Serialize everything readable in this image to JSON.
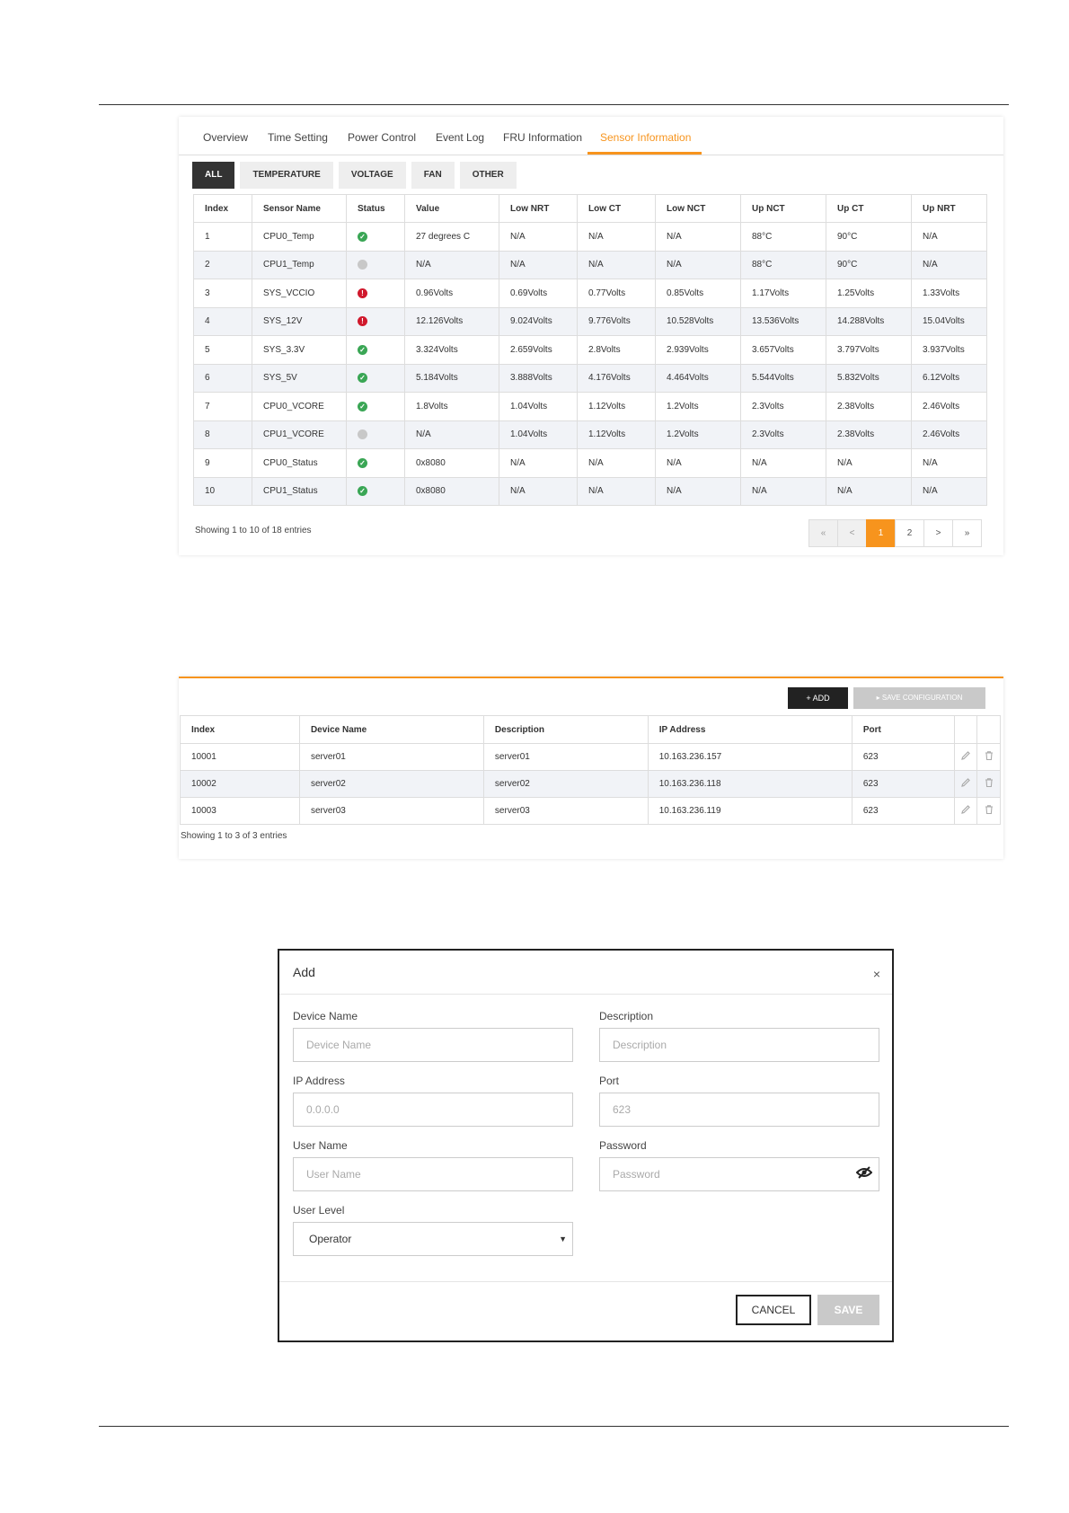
{
  "sensor_panel": {
    "tabs": [
      "Overview",
      "Time Setting",
      "Power Control",
      "Event Log",
      "FRU Information",
      "Sensor Information"
    ],
    "active_tab": "Sensor Information",
    "filters": [
      "ALL",
      "TEMPERATURE",
      "VOLTAGE",
      "FAN",
      "OTHER"
    ],
    "active_filter": "ALL",
    "columns": [
      "Index",
      "Sensor Name",
      "Status",
      "Value",
      "Low NRT",
      "Low CT",
      "Low NCT",
      "Up NCT",
      "Up CT",
      "Up NRT"
    ],
    "rows": [
      {
        "index": "1",
        "name": "CPU0_Temp",
        "status": "ok",
        "value": "27 degrees C",
        "low_nrt": "N/A",
        "low_ct": "N/A",
        "low_nct": "N/A",
        "up_nct": "88°C",
        "up_ct": "90°C",
        "up_nrt": "N/A"
      },
      {
        "index": "2",
        "name": "CPU1_Temp",
        "status": "off",
        "value": "N/A",
        "low_nrt": "N/A",
        "low_ct": "N/A",
        "low_nct": "N/A",
        "up_nct": "88°C",
        "up_ct": "90°C",
        "up_nrt": "N/A"
      },
      {
        "index": "3",
        "name": "SYS_VCCIO",
        "status": "err",
        "value": "0.96Volts",
        "low_nrt": "0.69Volts",
        "low_ct": "0.77Volts",
        "low_nct": "0.85Volts",
        "up_nct": "1.17Volts",
        "up_ct": "1.25Volts",
        "up_nrt": "1.33Volts"
      },
      {
        "index": "4",
        "name": "SYS_12V",
        "status": "err",
        "value": "12.126Volts",
        "low_nrt": "9.024Volts",
        "low_ct": "9.776Volts",
        "low_nct": "10.528Volts",
        "up_nct": "13.536Volts",
        "up_ct": "14.288Volts",
        "up_nrt": "15.04Volts"
      },
      {
        "index": "5",
        "name": "SYS_3.3V",
        "status": "ok",
        "value": "3.324Volts",
        "low_nrt": "2.659Volts",
        "low_ct": "2.8Volts",
        "low_nct": "2.939Volts",
        "up_nct": "3.657Volts",
        "up_ct": "3.797Volts",
        "up_nrt": "3.937Volts"
      },
      {
        "index": "6",
        "name": "SYS_5V",
        "status": "ok",
        "value": "5.184Volts",
        "low_nrt": "3.888Volts",
        "low_ct": "4.176Volts",
        "low_nct": "4.464Volts",
        "up_nct": "5.544Volts",
        "up_ct": "5.832Volts",
        "up_nrt": "6.12Volts"
      },
      {
        "index": "7",
        "name": "CPU0_VCORE",
        "status": "ok",
        "value": "1.8Volts",
        "low_nrt": "1.04Volts",
        "low_ct": "1.12Volts",
        "low_nct": "1.2Volts",
        "up_nct": "2.3Volts",
        "up_ct": "2.38Volts",
        "up_nrt": "2.46Volts"
      },
      {
        "index": "8",
        "name": "CPU1_VCORE",
        "status": "off",
        "value": "N/A",
        "low_nrt": "1.04Volts",
        "low_ct": "1.12Volts",
        "low_nct": "1.2Volts",
        "up_nct": "2.3Volts",
        "up_ct": "2.38Volts",
        "up_nrt": "2.46Volts"
      },
      {
        "index": "9",
        "name": "CPU0_Status",
        "status": "ok",
        "value": "0x8080",
        "low_nrt": "N/A",
        "low_ct": "N/A",
        "low_nct": "N/A",
        "up_nct": "N/A",
        "up_ct": "N/A",
        "up_nrt": "N/A"
      },
      {
        "index": "10",
        "name": "CPU1_Status",
        "status": "ok",
        "value": "0x8080",
        "low_nrt": "N/A",
        "low_ct": "N/A",
        "low_nct": "N/A",
        "up_nct": "N/A",
        "up_ct": "N/A",
        "up_nrt": "N/A"
      }
    ],
    "showing": "Showing 1 to 10 of 18 entries",
    "pagination": [
      "«",
      "<",
      "1",
      "2",
      ">",
      "»"
    ],
    "current_page": "1"
  },
  "device_panel": {
    "add_label": "+ ADD",
    "save_config_label": "▸ SAVE CONFIGURATION",
    "columns": [
      "Index",
      "Device Name",
      "Description",
      "IP Address",
      "Port"
    ],
    "rows": [
      {
        "index": "10001",
        "name": "server01",
        "description": "server01",
        "ip": "10.163.236.157",
        "port": "623"
      },
      {
        "index": "10002",
        "name": "server02",
        "description": "server02",
        "ip": "10.163.236.118",
        "port": "623"
      },
      {
        "index": "10003",
        "name": "server03",
        "description": "server03",
        "ip": "10.163.236.119",
        "port": "623"
      }
    ],
    "showing": "Showing 1 to 3 of 3 entries"
  },
  "add_dialog": {
    "title": "Add",
    "close": "×",
    "device_name": {
      "label": "Device Name",
      "placeholder": "Device Name"
    },
    "description": {
      "label": "Description",
      "placeholder": "Description"
    },
    "ip_address": {
      "label": "IP Address",
      "placeholder": "0.0.0.0"
    },
    "port": {
      "label": "Port",
      "placeholder": "623"
    },
    "user_name": {
      "label": "User Name",
      "placeholder": "User Name"
    },
    "password": {
      "label": "Password",
      "placeholder": "Password"
    },
    "user_level": {
      "label": "User Level",
      "value": "Operator"
    },
    "cancel_label": "CANCEL",
    "save_label": "SAVE"
  },
  "colors": {
    "accent": "#f7941d",
    "ok": "#3aa655",
    "error": "#d0182c",
    "offline": "#c8c8c8"
  }
}
